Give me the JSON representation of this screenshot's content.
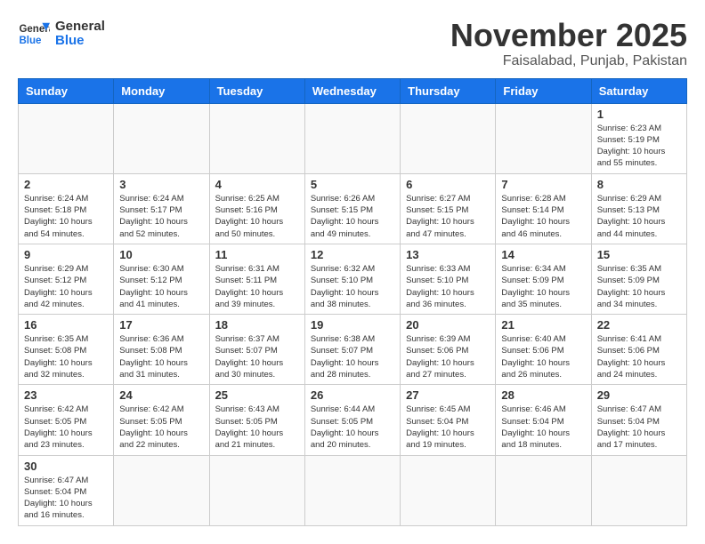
{
  "header": {
    "logo_general": "General",
    "logo_blue": "Blue",
    "month_title": "November 2025",
    "subtitle": "Faisalabad, Punjab, Pakistan"
  },
  "days_of_week": [
    "Sunday",
    "Monday",
    "Tuesday",
    "Wednesday",
    "Thursday",
    "Friday",
    "Saturday"
  ],
  "weeks": [
    [
      {
        "day": "",
        "info": ""
      },
      {
        "day": "",
        "info": ""
      },
      {
        "day": "",
        "info": ""
      },
      {
        "day": "",
        "info": ""
      },
      {
        "day": "",
        "info": ""
      },
      {
        "day": "",
        "info": ""
      },
      {
        "day": "1",
        "info": "Sunrise: 6:23 AM\nSunset: 5:19 PM\nDaylight: 10 hours and 55 minutes."
      }
    ],
    [
      {
        "day": "2",
        "info": "Sunrise: 6:24 AM\nSunset: 5:18 PM\nDaylight: 10 hours and 54 minutes."
      },
      {
        "day": "3",
        "info": "Sunrise: 6:24 AM\nSunset: 5:17 PM\nDaylight: 10 hours and 52 minutes."
      },
      {
        "day": "4",
        "info": "Sunrise: 6:25 AM\nSunset: 5:16 PM\nDaylight: 10 hours and 50 minutes."
      },
      {
        "day": "5",
        "info": "Sunrise: 6:26 AM\nSunset: 5:15 PM\nDaylight: 10 hours and 49 minutes."
      },
      {
        "day": "6",
        "info": "Sunrise: 6:27 AM\nSunset: 5:15 PM\nDaylight: 10 hours and 47 minutes."
      },
      {
        "day": "7",
        "info": "Sunrise: 6:28 AM\nSunset: 5:14 PM\nDaylight: 10 hours and 46 minutes."
      },
      {
        "day": "8",
        "info": "Sunrise: 6:29 AM\nSunset: 5:13 PM\nDaylight: 10 hours and 44 minutes."
      }
    ],
    [
      {
        "day": "9",
        "info": "Sunrise: 6:29 AM\nSunset: 5:12 PM\nDaylight: 10 hours and 42 minutes."
      },
      {
        "day": "10",
        "info": "Sunrise: 6:30 AM\nSunset: 5:12 PM\nDaylight: 10 hours and 41 minutes."
      },
      {
        "day": "11",
        "info": "Sunrise: 6:31 AM\nSunset: 5:11 PM\nDaylight: 10 hours and 39 minutes."
      },
      {
        "day": "12",
        "info": "Sunrise: 6:32 AM\nSunset: 5:10 PM\nDaylight: 10 hours and 38 minutes."
      },
      {
        "day": "13",
        "info": "Sunrise: 6:33 AM\nSunset: 5:10 PM\nDaylight: 10 hours and 36 minutes."
      },
      {
        "day": "14",
        "info": "Sunrise: 6:34 AM\nSunset: 5:09 PM\nDaylight: 10 hours and 35 minutes."
      },
      {
        "day": "15",
        "info": "Sunrise: 6:35 AM\nSunset: 5:09 PM\nDaylight: 10 hours and 34 minutes."
      }
    ],
    [
      {
        "day": "16",
        "info": "Sunrise: 6:35 AM\nSunset: 5:08 PM\nDaylight: 10 hours and 32 minutes."
      },
      {
        "day": "17",
        "info": "Sunrise: 6:36 AM\nSunset: 5:08 PM\nDaylight: 10 hours and 31 minutes."
      },
      {
        "day": "18",
        "info": "Sunrise: 6:37 AM\nSunset: 5:07 PM\nDaylight: 10 hours and 30 minutes."
      },
      {
        "day": "19",
        "info": "Sunrise: 6:38 AM\nSunset: 5:07 PM\nDaylight: 10 hours and 28 minutes."
      },
      {
        "day": "20",
        "info": "Sunrise: 6:39 AM\nSunset: 5:06 PM\nDaylight: 10 hours and 27 minutes."
      },
      {
        "day": "21",
        "info": "Sunrise: 6:40 AM\nSunset: 5:06 PM\nDaylight: 10 hours and 26 minutes."
      },
      {
        "day": "22",
        "info": "Sunrise: 6:41 AM\nSunset: 5:06 PM\nDaylight: 10 hours and 24 minutes."
      }
    ],
    [
      {
        "day": "23",
        "info": "Sunrise: 6:42 AM\nSunset: 5:05 PM\nDaylight: 10 hours and 23 minutes."
      },
      {
        "day": "24",
        "info": "Sunrise: 6:42 AM\nSunset: 5:05 PM\nDaylight: 10 hours and 22 minutes."
      },
      {
        "day": "25",
        "info": "Sunrise: 6:43 AM\nSunset: 5:05 PM\nDaylight: 10 hours and 21 minutes."
      },
      {
        "day": "26",
        "info": "Sunrise: 6:44 AM\nSunset: 5:05 PM\nDaylight: 10 hours and 20 minutes."
      },
      {
        "day": "27",
        "info": "Sunrise: 6:45 AM\nSunset: 5:04 PM\nDaylight: 10 hours and 19 minutes."
      },
      {
        "day": "28",
        "info": "Sunrise: 6:46 AM\nSunset: 5:04 PM\nDaylight: 10 hours and 18 minutes."
      },
      {
        "day": "29",
        "info": "Sunrise: 6:47 AM\nSunset: 5:04 PM\nDaylight: 10 hours and 17 minutes."
      }
    ],
    [
      {
        "day": "30",
        "info": "Sunrise: 6:47 AM\nSunset: 5:04 PM\nDaylight: 10 hours and 16 minutes."
      },
      {
        "day": "",
        "info": ""
      },
      {
        "day": "",
        "info": ""
      },
      {
        "day": "",
        "info": ""
      },
      {
        "day": "",
        "info": ""
      },
      {
        "day": "",
        "info": ""
      },
      {
        "day": "",
        "info": ""
      }
    ]
  ]
}
